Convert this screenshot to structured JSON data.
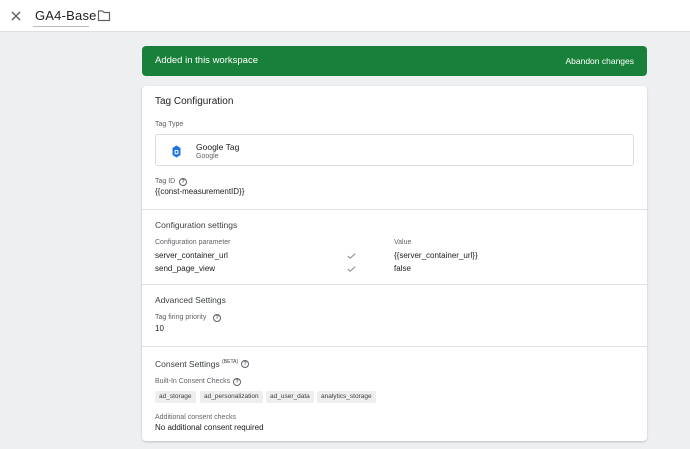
{
  "header": {
    "title": "GA4-Base",
    "close_icon": "close-icon",
    "folder_icon": "folder-icon"
  },
  "banner": {
    "text": "Added in this workspace",
    "action": "Abandon changes",
    "color": "#188038"
  },
  "card": {
    "title": "Tag Configuration",
    "tag_type": {
      "label": "Tag Type",
      "name": "Google Tag",
      "subtitle": "Google",
      "icon": "google-tag-icon",
      "icon_color": "#1a73e8"
    },
    "tag_id": {
      "label": "Tag ID",
      "value": "{{const-measurementID}}"
    },
    "config_settings": {
      "heading": "Configuration settings",
      "col_param": "Configuration parameter",
      "col_value": "Value",
      "rows": [
        {
          "param": "server_container_url",
          "value": "{{server_container_url}}"
        },
        {
          "param": "send_page_view",
          "value": "false"
        }
      ]
    },
    "advanced": {
      "heading": "Advanced Settings",
      "priority_label": "Tag firing priority",
      "priority_value": "10"
    },
    "consent": {
      "heading": "Consent Settings",
      "badge": "(BETA)",
      "builtin_label": "Built-In Consent Checks",
      "chips": [
        "ad_storage",
        "ad_personalization",
        "ad_user_data",
        "analytics_storage"
      ],
      "additional_label": "Additional consent checks",
      "additional_value": "No additional consent required"
    }
  }
}
